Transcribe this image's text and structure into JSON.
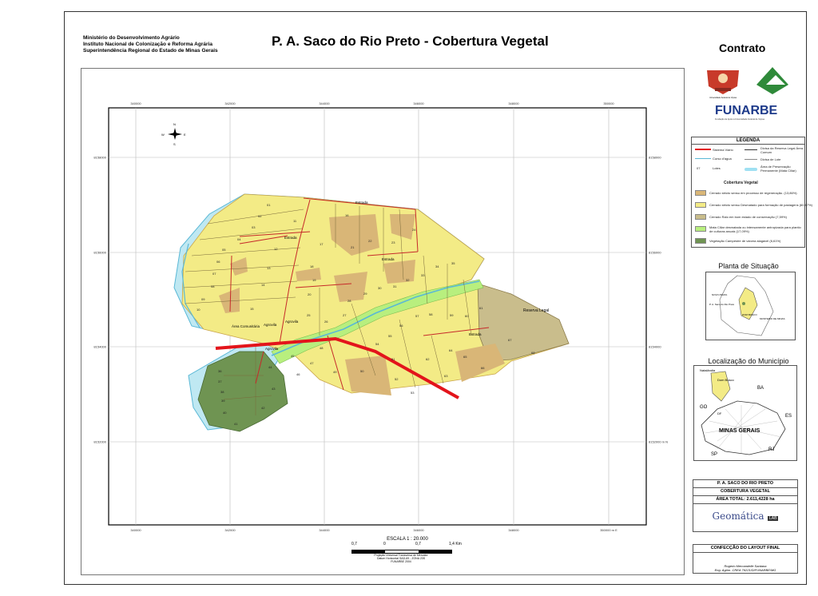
{
  "header": {
    "institution_lines": [
      "Ministério do Desenvolvimento Agrário",
      "Instituto Nacional de Colonização e Reforma Agrária",
      "Superintendência Regional do Estado de Minas Gerais"
    ],
    "title": "P. A. Saco do Rio Preto - Cobertura Vegetal",
    "contract_label": "Contrato"
  },
  "logos": {
    "funarbe": "FUNARBE",
    "funarbe_sub": "Fundação de Apoio à Universidade Federal de Viçosa",
    "ufv_caption": "Universidade Federal de Viçosa",
    "geomatica": "Geomática",
    "geomatica_lab": "LAB"
  },
  "map": {
    "top_ticks": [
      "340000",
      "342000",
      "344000",
      "346000",
      "348000",
      "350000"
    ],
    "left_ticks": [
      "8158000",
      "8156000",
      "8154000",
      "8152000"
    ],
    "right_ticks": [
      "8158000",
      "8156000",
      "8154000",
      "8152000 m N"
    ],
    "bottom_ticks": [
      "340000",
      "342000",
      "344000",
      "346000",
      "348000",
      "350000 m E"
    ],
    "north": {
      "N": "N",
      "S": "S",
      "E": "E",
      "W": "W"
    },
    "area_labels": [
      "Área Comunitária",
      "Agrovila",
      "Agrovila",
      "Agrovila",
      "Reserva Legal"
    ],
    "road_labels": [
      "Estrada",
      "Estrada",
      "Estrada",
      "Estrada"
    ],
    "lots": [
      "01",
      "02",
      "03",
      "04",
      "05",
      "06",
      "07",
      "08",
      "09",
      "10",
      "11",
      "12",
      "13",
      "14",
      "15",
      "16",
      "17",
      "18",
      "19",
      "20",
      "21",
      "22",
      "23",
      "24",
      "25",
      "26",
      "27",
      "28",
      "29",
      "30",
      "31",
      "32",
      "33",
      "34",
      "35",
      "36",
      "37",
      "38",
      "39",
      "40",
      "41",
      "42",
      "43",
      "44",
      "45",
      "46",
      "47",
      "48",
      "49",
      "50",
      "51",
      "52",
      "53",
      "54",
      "55",
      "56",
      "57",
      "58",
      "59",
      "60",
      "61",
      "62",
      "63",
      "64",
      "65",
      "66",
      "67",
      "68"
    ]
  },
  "legend": {
    "title": "LEGENDA",
    "line_items": [
      "Sistema Viário",
      "Curso d'água",
      "Lotes",
      "Divisa da Reserva Legal Área Comum",
      "Divisa de Lote",
      "Área de Preservação Permanente (Mata Ciliar)"
    ],
    "lot_sample": "07",
    "cover_title": "Cobertura Vegetal",
    "cover_items": [
      {
        "label": "Cerrado stricto sensu em processo de regeneração. (13,86%)",
        "color": "#d9b677"
      },
      {
        "label": "Cerrado stricto sensu Desmatado para formação de pastagens (60,87%)",
        "color": "#f3eb86"
      },
      {
        "label": "Cerrado Ralo em bom estado de conservação (7,59%)",
        "color": "#c9bd8c"
      },
      {
        "label": "Mata Ciliar desmatada ou intensamente antropizada para plantio de culturas anuais (17,09%)",
        "color": "#b8ef7e"
      },
      {
        "label": "Vegetação Campestre de várzea alagável (6,61%)",
        "color": "#6f9452"
      }
    ]
  },
  "situacao": {
    "title": "Planta de Situação",
    "labels": [
      "NOVO PRATA",
      "P. A. Saco do Rio Preto",
      "DOM BOSCO",
      "MONTEIRO DE MINAS"
    ]
  },
  "municipio": {
    "title": "Localização do Município",
    "labels": [
      "Natalândia",
      "Dom Bosco",
      "BA",
      "GO",
      "ES",
      "DF",
      "MINAS GERAIS",
      "SP",
      "RJ"
    ]
  },
  "info": {
    "project": "P. A. SACO DO RIO PRETO",
    "subject": "COBERTURA VEGETAL",
    "area": "ÁREA TOTAL: 2.611,4228 ha"
  },
  "confeccao": {
    "title": "CONFECÇÃO DO LAYOUT FINAL",
    "author": "Rogerio Mercandelle Santana",
    "role": "Eng. Agrim. CREA 76221/D/FUNARBE/MG"
  },
  "scale": {
    "label": "ESCALA 1 : 20.000",
    "ticks": [
      "0,7",
      "0",
      "0,7",
      "1,4 Km"
    ],
    "projection": "Projeção Universal Transversa de Mercator",
    "datum": "Datum Horizontal SAD-69 - ZONA 23S",
    "credit": "FUNARBE 2004"
  }
}
